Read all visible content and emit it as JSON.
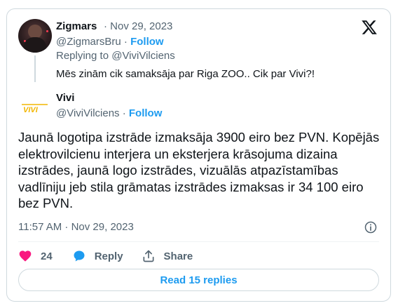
{
  "parent_tweet": {
    "display_name": "Zigmars",
    "date": "· Nov 29, 2023",
    "handle": "@ZigmarsBru",
    "separator": " · ",
    "follow_label": "Follow",
    "replying_to": "Replying to @ViviVilciens",
    "text": "Mēs zinām cik samaksāja par Riga ZOO.. Cik par Vivi?!"
  },
  "main_tweet": {
    "display_name": "Vivi",
    "handle": "@ViviVilciens",
    "separator": " · ",
    "follow_label": "Follow",
    "logo_text": "VIVI",
    "text": "Jaunā logotipa izstrāde izmaksāja 3900 eiro bez PVN. Kopējās elektrovilcienu interjera un eksterjera krāsojuma dizaina izstrādes, jaunā logo izstrādes, vizuālās atpazīstamības vadlīniju jeb stila grāmatas izstrādes izmaksas ir 34 100 eiro bez PVN.",
    "timestamp": "11:57 AM · Nov 29, 2023"
  },
  "actions": {
    "like_count": "24",
    "reply_label": "Reply",
    "share_label": "Share"
  },
  "read_replies_label": "Read 15 replies",
  "colors": {
    "accent": "#1d9bf0",
    "like": "#f91880",
    "secondary_text": "#536471",
    "vivi_logo": "#f2b600"
  },
  "icons": [
    "x-logo-icon",
    "info-icon",
    "heart-icon",
    "reply-bubble-icon",
    "share-icon"
  ]
}
